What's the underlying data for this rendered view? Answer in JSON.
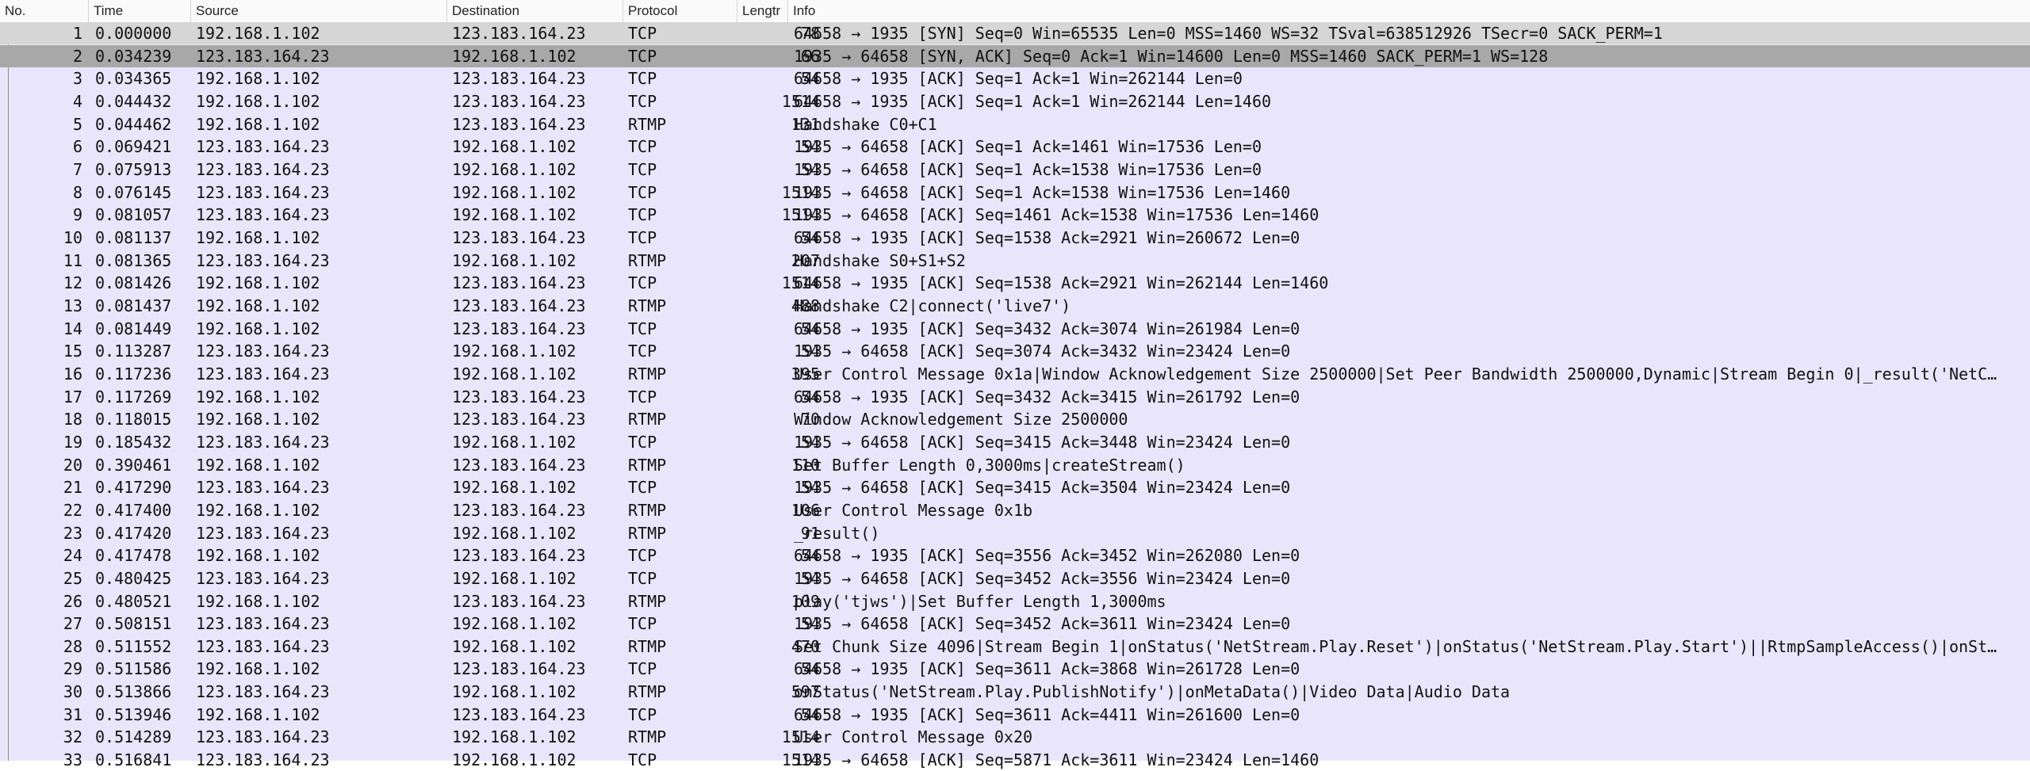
{
  "columns": {
    "no": "No.",
    "time": "Time",
    "source": "Source",
    "destination": "Destination",
    "protocol": "Protocol",
    "length": "Lengtr",
    "info": "Info"
  },
  "selected_row": 2,
  "packets": [
    {
      "no": "1",
      "time": "0.000000",
      "source": "192.168.1.102",
      "destination": "123.183.164.23",
      "protocol": "TCP",
      "length": "78",
      "info": "64658 → 1935 [SYN] Seq=0 Win=65535 Len=0 MSS=1460 WS=32 TSval=638512926 TSecr=0 SACK_PERM=1"
    },
    {
      "no": "2",
      "time": "0.034239",
      "source": "123.183.164.23",
      "destination": "192.168.1.102",
      "protocol": "TCP",
      "length": "66",
      "info": "1935 → 64658 [SYN, ACK] Seq=0 Ack=1 Win=14600 Len=0 MSS=1460 SACK_PERM=1 WS=128"
    },
    {
      "no": "3",
      "time": "0.034365",
      "source": "192.168.1.102",
      "destination": "123.183.164.23",
      "protocol": "TCP",
      "length": "54",
      "info": "64658 → 1935 [ACK] Seq=1 Ack=1 Win=262144 Len=0"
    },
    {
      "no": "4",
      "time": "0.044432",
      "source": "192.168.1.102",
      "destination": "123.183.164.23",
      "protocol": "TCP",
      "length": "1514",
      "info": "64658 → 1935 [ACK] Seq=1 Ack=1 Win=262144 Len=1460"
    },
    {
      "no": "5",
      "time": "0.044462",
      "source": "192.168.1.102",
      "destination": "123.183.164.23",
      "protocol": "RTMP",
      "length": "131",
      "info": "Handshake C0+C1"
    },
    {
      "no": "6",
      "time": "0.069421",
      "source": "123.183.164.23",
      "destination": "192.168.1.102",
      "protocol": "TCP",
      "length": "54",
      "info": "1935 → 64658 [ACK] Seq=1 Ack=1461 Win=17536 Len=0"
    },
    {
      "no": "7",
      "time": "0.075913",
      "source": "123.183.164.23",
      "destination": "192.168.1.102",
      "protocol": "TCP",
      "length": "54",
      "info": "1935 → 64658 [ACK] Seq=1 Ack=1538 Win=17536 Len=0"
    },
    {
      "no": "8",
      "time": "0.076145",
      "source": "123.183.164.23",
      "destination": "192.168.1.102",
      "protocol": "TCP",
      "length": "1514",
      "info": "1935 → 64658 [ACK] Seq=1 Ack=1538 Win=17536 Len=1460"
    },
    {
      "no": "9",
      "time": "0.081057",
      "source": "123.183.164.23",
      "destination": "192.168.1.102",
      "protocol": "TCP",
      "length": "1514",
      "info": "1935 → 64658 [ACK] Seq=1461 Ack=1538 Win=17536 Len=1460"
    },
    {
      "no": "10",
      "time": "0.081137",
      "source": "192.168.1.102",
      "destination": "123.183.164.23",
      "protocol": "TCP",
      "length": "54",
      "info": "64658 → 1935 [ACK] Seq=1538 Ack=2921 Win=260672 Len=0"
    },
    {
      "no": "11",
      "time": "0.081365",
      "source": "123.183.164.23",
      "destination": "192.168.1.102",
      "protocol": "RTMP",
      "length": "207",
      "info": "Handshake S0+S1+S2"
    },
    {
      "no": "12",
      "time": "0.081426",
      "source": "192.168.1.102",
      "destination": "123.183.164.23",
      "protocol": "TCP",
      "length": "1514",
      "info": "64658 → 1935 [ACK] Seq=1538 Ack=2921 Win=262144 Len=1460"
    },
    {
      "no": "13",
      "time": "0.081437",
      "source": "192.168.1.102",
      "destination": "123.183.164.23",
      "protocol": "RTMP",
      "length": "488",
      "info": "Handshake C2|connect('live7')"
    },
    {
      "no": "14",
      "time": "0.081449",
      "source": "192.168.1.102",
      "destination": "123.183.164.23",
      "protocol": "TCP",
      "length": "54",
      "info": "64658 → 1935 [ACK] Seq=3432 Ack=3074 Win=261984 Len=0"
    },
    {
      "no": "15",
      "time": "0.113287",
      "source": "123.183.164.23",
      "destination": "192.168.1.102",
      "protocol": "TCP",
      "length": "54",
      "info": "1935 → 64658 [ACK] Seq=3074 Ack=3432 Win=23424 Len=0"
    },
    {
      "no": "16",
      "time": "0.117236",
      "source": "123.183.164.23",
      "destination": "192.168.1.102",
      "protocol": "RTMP",
      "length": "395",
      "info": "User Control Message 0x1a|Window Acknowledgement Size 2500000|Set Peer Bandwidth 2500000,Dynamic|Stream Begin 0|_result('NetC…"
    },
    {
      "no": "17",
      "time": "0.117269",
      "source": "192.168.1.102",
      "destination": "123.183.164.23",
      "protocol": "TCP",
      "length": "54",
      "info": "64658 → 1935 [ACK] Seq=3432 Ack=3415 Win=261792 Len=0"
    },
    {
      "no": "18",
      "time": "0.118015",
      "source": "192.168.1.102",
      "destination": "123.183.164.23",
      "protocol": "RTMP",
      "length": "70",
      "info": "Window Acknowledgement Size 2500000"
    },
    {
      "no": "19",
      "time": "0.185432",
      "source": "123.183.164.23",
      "destination": "192.168.1.102",
      "protocol": "TCP",
      "length": "54",
      "info": "1935 → 64658 [ACK] Seq=3415 Ack=3448 Win=23424 Len=0"
    },
    {
      "no": "20",
      "time": "0.390461",
      "source": "192.168.1.102",
      "destination": "123.183.164.23",
      "protocol": "RTMP",
      "length": "110",
      "info": "Set Buffer Length 0,3000ms|createStream()"
    },
    {
      "no": "21",
      "time": "0.417290",
      "source": "123.183.164.23",
      "destination": "192.168.1.102",
      "protocol": "TCP",
      "length": "54",
      "info": "1935 → 64658 [ACK] Seq=3415 Ack=3504 Win=23424 Len=0"
    },
    {
      "no": "22",
      "time": "0.417400",
      "source": "192.168.1.102",
      "destination": "123.183.164.23",
      "protocol": "RTMP",
      "length": "106",
      "info": "User Control Message 0x1b"
    },
    {
      "no": "23",
      "time": "0.417420",
      "source": "123.183.164.23",
      "destination": "192.168.1.102",
      "protocol": "RTMP",
      "length": "91",
      "info": "_result()"
    },
    {
      "no": "24",
      "time": "0.417478",
      "source": "192.168.1.102",
      "destination": "123.183.164.23",
      "protocol": "TCP",
      "length": "54",
      "info": "64658 → 1935 [ACK] Seq=3556 Ack=3452 Win=262080 Len=0"
    },
    {
      "no": "25",
      "time": "0.480425",
      "source": "123.183.164.23",
      "destination": "192.168.1.102",
      "protocol": "TCP",
      "length": "54",
      "info": "1935 → 64658 [ACK] Seq=3452 Ack=3556 Win=23424 Len=0"
    },
    {
      "no": "26",
      "time": "0.480521",
      "source": "192.168.1.102",
      "destination": "123.183.164.23",
      "protocol": "RTMP",
      "length": "109",
      "info": "play('tjws')|Set Buffer Length 1,3000ms"
    },
    {
      "no": "27",
      "time": "0.508151",
      "source": "123.183.164.23",
      "destination": "192.168.1.102",
      "protocol": "TCP",
      "length": "54",
      "info": "1935 → 64658 [ACK] Seq=3452 Ack=3611 Win=23424 Len=0"
    },
    {
      "no": "28",
      "time": "0.511552",
      "source": "123.183.164.23",
      "destination": "192.168.1.102",
      "protocol": "RTMP",
      "length": "470",
      "info": "Set Chunk Size 4096|Stream Begin 1|onStatus('NetStream.Play.Reset')|onStatus('NetStream.Play.Start')||RtmpSampleAccess()|onSt…"
    },
    {
      "no": "29",
      "time": "0.511586",
      "source": "192.168.1.102",
      "destination": "123.183.164.23",
      "protocol": "TCP",
      "length": "54",
      "info": "64658 → 1935 [ACK] Seq=3611 Ack=3868 Win=261728 Len=0"
    },
    {
      "no": "30",
      "time": "0.513866",
      "source": "123.183.164.23",
      "destination": "192.168.1.102",
      "protocol": "RTMP",
      "length": "597",
      "info": "onStatus('NetStream.Play.PublishNotify')|onMetaData()|Video Data|Audio Data"
    },
    {
      "no": "31",
      "time": "0.513946",
      "source": "192.168.1.102",
      "destination": "123.183.164.23",
      "protocol": "TCP",
      "length": "54",
      "info": "64658 → 1935 [ACK] Seq=3611 Ack=4411 Win=261600 Len=0"
    },
    {
      "no": "32",
      "time": "0.514289",
      "source": "123.183.164.23",
      "destination": "192.168.1.102",
      "protocol": "RTMP",
      "length": "1514",
      "info": "User Control Message 0x20"
    },
    {
      "no": "33",
      "time": "0.516841",
      "source": "123.183.164.23",
      "destination": "192.168.1.102",
      "protocol": "TCP",
      "length": "1514",
      "info": "1935 → 64658 [ACK] Seq=5871 Ack=3611 Win=23424 Len=1460"
    }
  ]
}
